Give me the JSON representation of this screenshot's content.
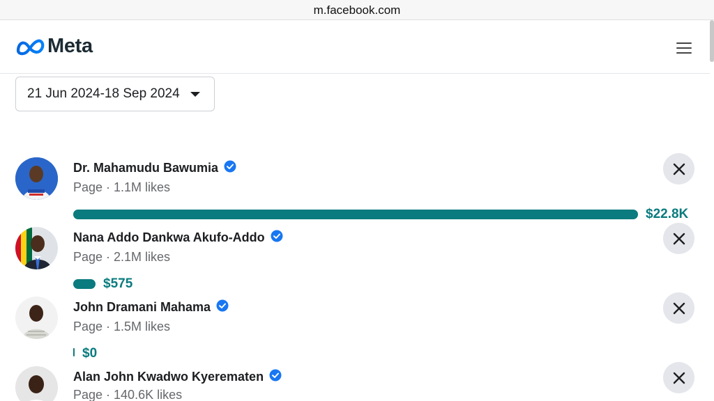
{
  "browser": {
    "url": "m.facebook.com"
  },
  "header": {
    "logo_text": "Meta",
    "logo_icon": "meta-infinity-logo",
    "menu_icon": "hamburger-menu-icon"
  },
  "date_range": {
    "label": "21 Jun 2024-18 Sep 2024",
    "icon": "caret-down-icon"
  },
  "colors": {
    "accent": "#0a7b7e",
    "verified": "#1877f2",
    "secondary_text": "#65676b"
  },
  "spend_max": 22800,
  "advertisers": [
    {
      "name": "Dr. Mahamudu Bawumia",
      "meta": "Page · 1.1M likes",
      "verified": true,
      "spend_label": "$22.8K",
      "spend_value": 22800
    },
    {
      "name": "Nana Addo Dankwa Akufo-Addo",
      "meta": "Page · 2.1M likes",
      "verified": true,
      "spend_label": "$575",
      "spend_value": 575
    },
    {
      "name": "John Dramani Mahama",
      "meta": "Page · 1.5M likes",
      "verified": true,
      "spend_label": "$0",
      "spend_value": 0
    },
    {
      "name": "Alan John Kwadwo Kyerematen",
      "meta": "Page · 140.6K likes",
      "verified": true
    }
  ]
}
